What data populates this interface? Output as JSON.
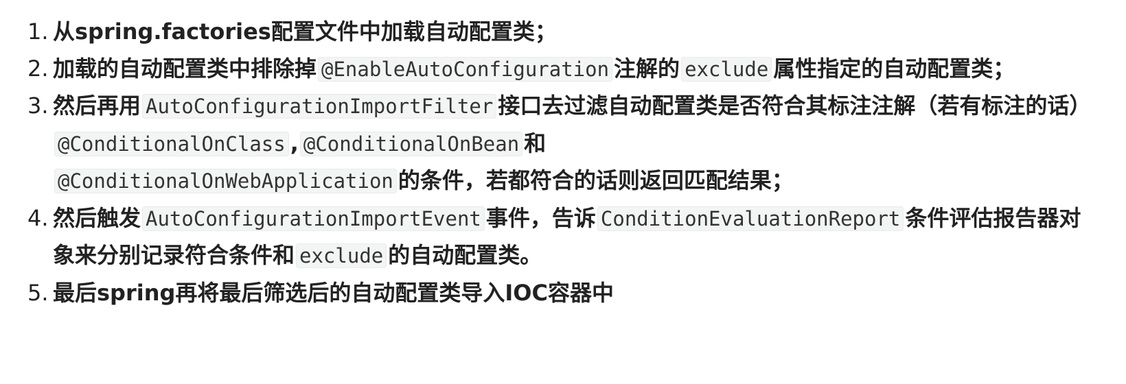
{
  "steps": [
    {
      "number": "1.",
      "parts": [
        {
          "type": "text",
          "value": "从spring.factories配置文件中加载自动配置类；"
        }
      ]
    },
    {
      "number": "2.",
      "parts": [
        {
          "type": "text",
          "value": "加载的自动配置类中排除掉"
        },
        {
          "type": "code",
          "value": "@EnableAutoConfiguration"
        },
        {
          "type": "text",
          "value": "注解的"
        },
        {
          "type": "code",
          "value": "exclude"
        },
        {
          "type": "text",
          "value": "属性指定的自动配置类；"
        }
      ]
    },
    {
      "number": "3.",
      "parts": [
        {
          "type": "text",
          "value": "然后再用"
        },
        {
          "type": "code",
          "value": "AutoConfigurationImportFilter"
        },
        {
          "type": "text",
          "value": "接口去过滤自动配置类是否符合其标注注解（若有标注的话）"
        },
        {
          "type": "code",
          "value": "@ConditionalOnClass"
        },
        {
          "type": "text",
          "value": ","
        },
        {
          "type": "code",
          "value": "@ConditionalOnBean"
        },
        {
          "type": "text",
          "value": "和"
        },
        {
          "type": "code",
          "value": "@ConditionalOnWebApplication"
        },
        {
          "type": "text",
          "value": "的条件，若都符合的话则返回匹配结果；"
        }
      ]
    },
    {
      "number": "4.",
      "parts": [
        {
          "type": "text",
          "value": "然后触发"
        },
        {
          "type": "code",
          "value": "AutoConfigurationImportEvent"
        },
        {
          "type": "text",
          "value": "事件，告诉"
        },
        {
          "type": "code",
          "value": "ConditionEvaluationReport"
        },
        {
          "type": "text",
          "value": "条件评估报告器对象来分别记录符合条件和"
        },
        {
          "type": "code",
          "value": "exclude"
        },
        {
          "type": "text",
          "value": "的自动配置类。"
        }
      ]
    },
    {
      "number": "5.",
      "parts": [
        {
          "type": "text",
          "value": "最后spring再将最后筛选后的自动配置类导入IOC容器中"
        }
      ]
    }
  ]
}
